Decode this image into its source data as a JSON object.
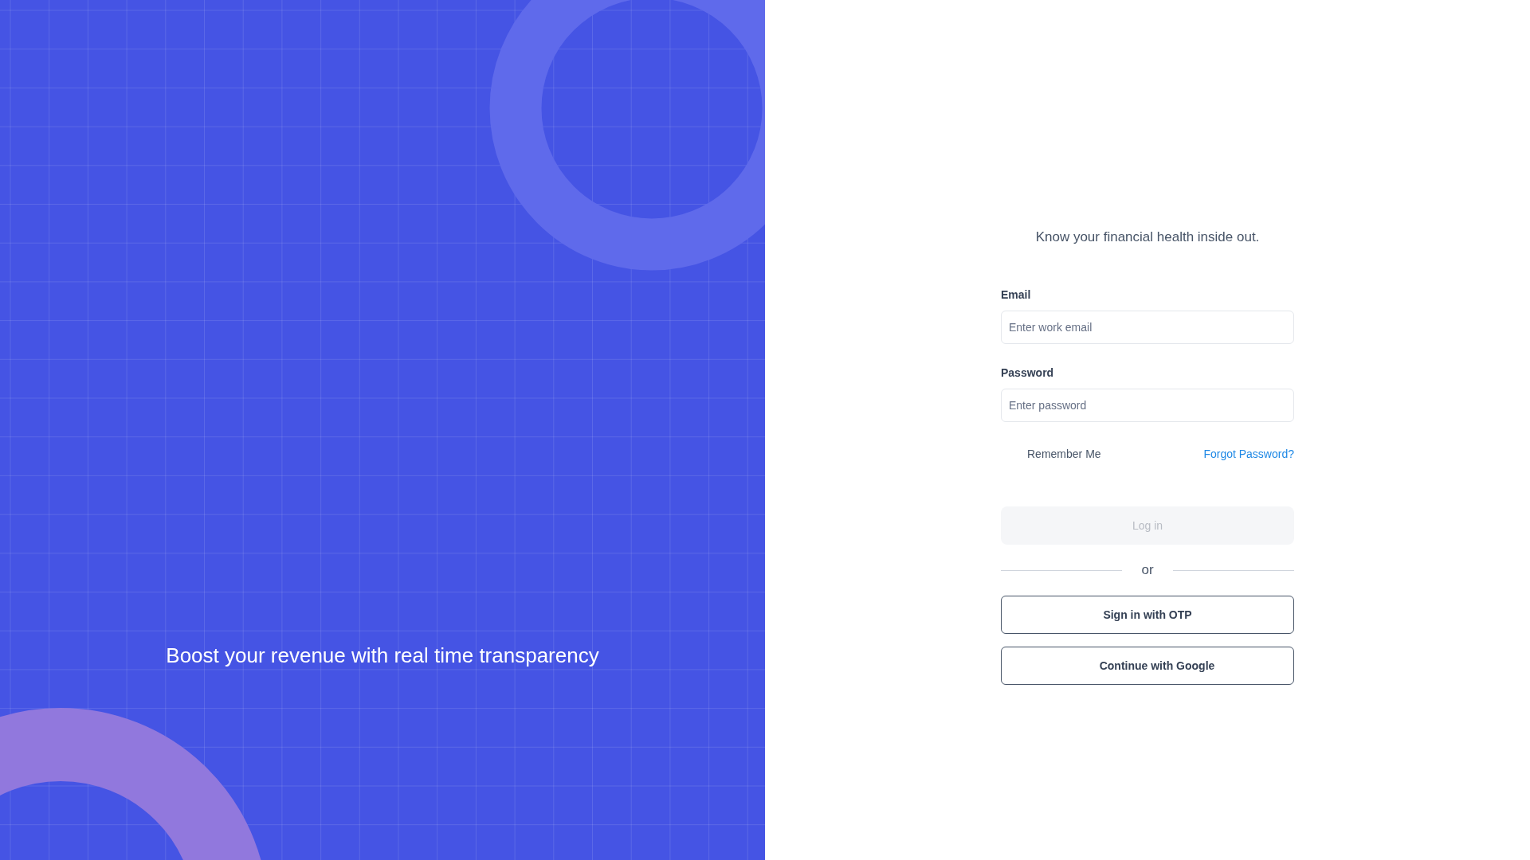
{
  "hero": {
    "tagline": "Boost your revenue with real time transparency"
  },
  "form": {
    "subtitle": "Know your financial health inside out.",
    "fields": [
      {
        "label": "Email",
        "placeholder": "Enter work email"
      },
      {
        "label": "Password",
        "placeholder": "Enter password"
      }
    ],
    "remember": {
      "label": "Remember Me"
    },
    "forgot_link": "Forgot Password?",
    "login_button": {
      "label": "Log in",
      "disabled": true
    },
    "divider": "or",
    "alt_buttons": [
      {
        "label": "Sign in with OTP",
        "kind": "otp"
      },
      {
        "label": "Continue with Google",
        "kind": "google"
      }
    ]
  }
}
